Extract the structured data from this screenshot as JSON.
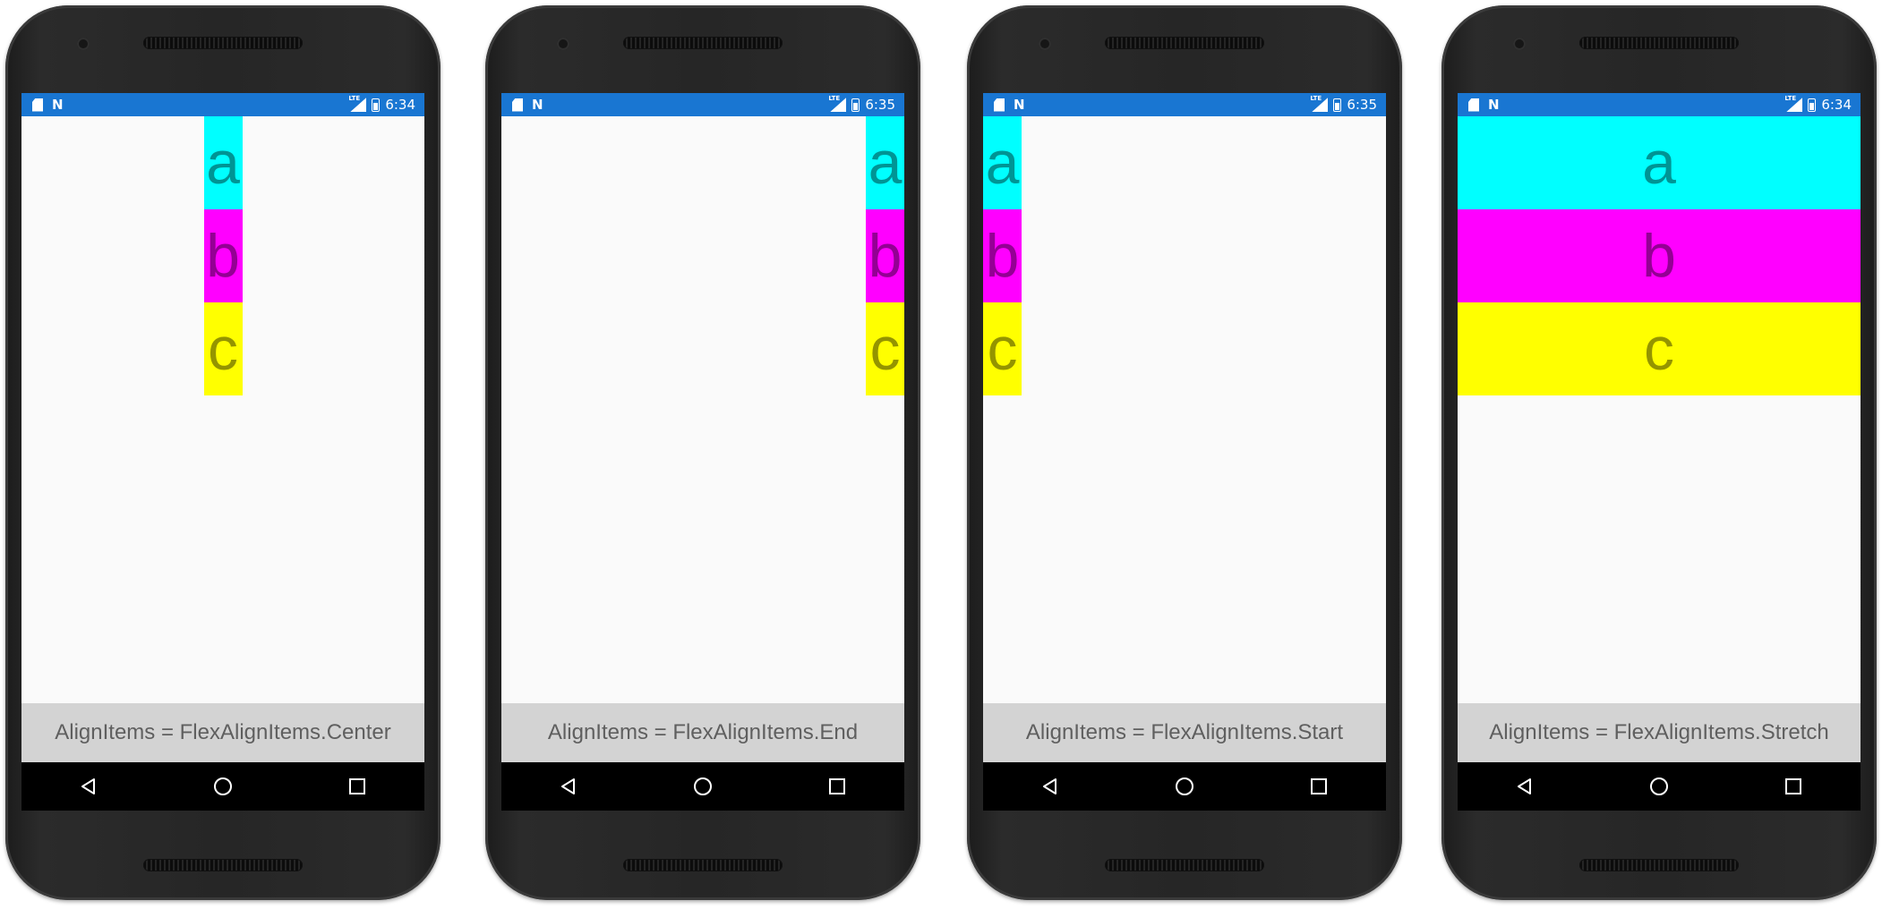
{
  "colors": {
    "status_bar": "#1976d2",
    "item_a": "#00ffff",
    "item_b": "#ff00ff",
    "item_c": "#ffff00",
    "label_background": "#d3d3d3",
    "screen_background": "#fafafa"
  },
  "status_icons": [
    "sd-card-icon",
    "n-notification-icon",
    "lte-signal-icon",
    "battery-icon"
  ],
  "nav_icons": [
    "back-icon",
    "home-icon",
    "recents-icon"
  ],
  "phones": [
    {
      "id": "center",
      "time": "6:34",
      "align_items": "center",
      "label": "AlignItems = FlexAlignItems.Center",
      "items": [
        {
          "text": "a",
          "color": "#00ffff"
        },
        {
          "text": "b",
          "color": "#ff00ff"
        },
        {
          "text": "c",
          "color": "#ffff00"
        }
      ]
    },
    {
      "id": "end",
      "time": "6:35",
      "align_items": "flex-end",
      "label": "AlignItems = FlexAlignItems.End",
      "items": [
        {
          "text": "a",
          "color": "#00ffff"
        },
        {
          "text": "b",
          "color": "#ff00ff"
        },
        {
          "text": "c",
          "color": "#ffff00"
        }
      ]
    },
    {
      "id": "start",
      "time": "6:35",
      "align_items": "flex-start",
      "label": "AlignItems = FlexAlignItems.Start",
      "items": [
        {
          "text": "a",
          "color": "#00ffff"
        },
        {
          "text": "b",
          "color": "#ff00ff"
        },
        {
          "text": "c",
          "color": "#ffff00"
        }
      ]
    },
    {
      "id": "stretch",
      "time": "6:34",
      "align_items": "stretch",
      "label": "AlignItems = FlexAlignItems.Stretch",
      "items": [
        {
          "text": "a",
          "color": "#00ffff"
        },
        {
          "text": "b",
          "color": "#ff00ff"
        },
        {
          "text": "c",
          "color": "#ffff00"
        }
      ]
    }
  ]
}
